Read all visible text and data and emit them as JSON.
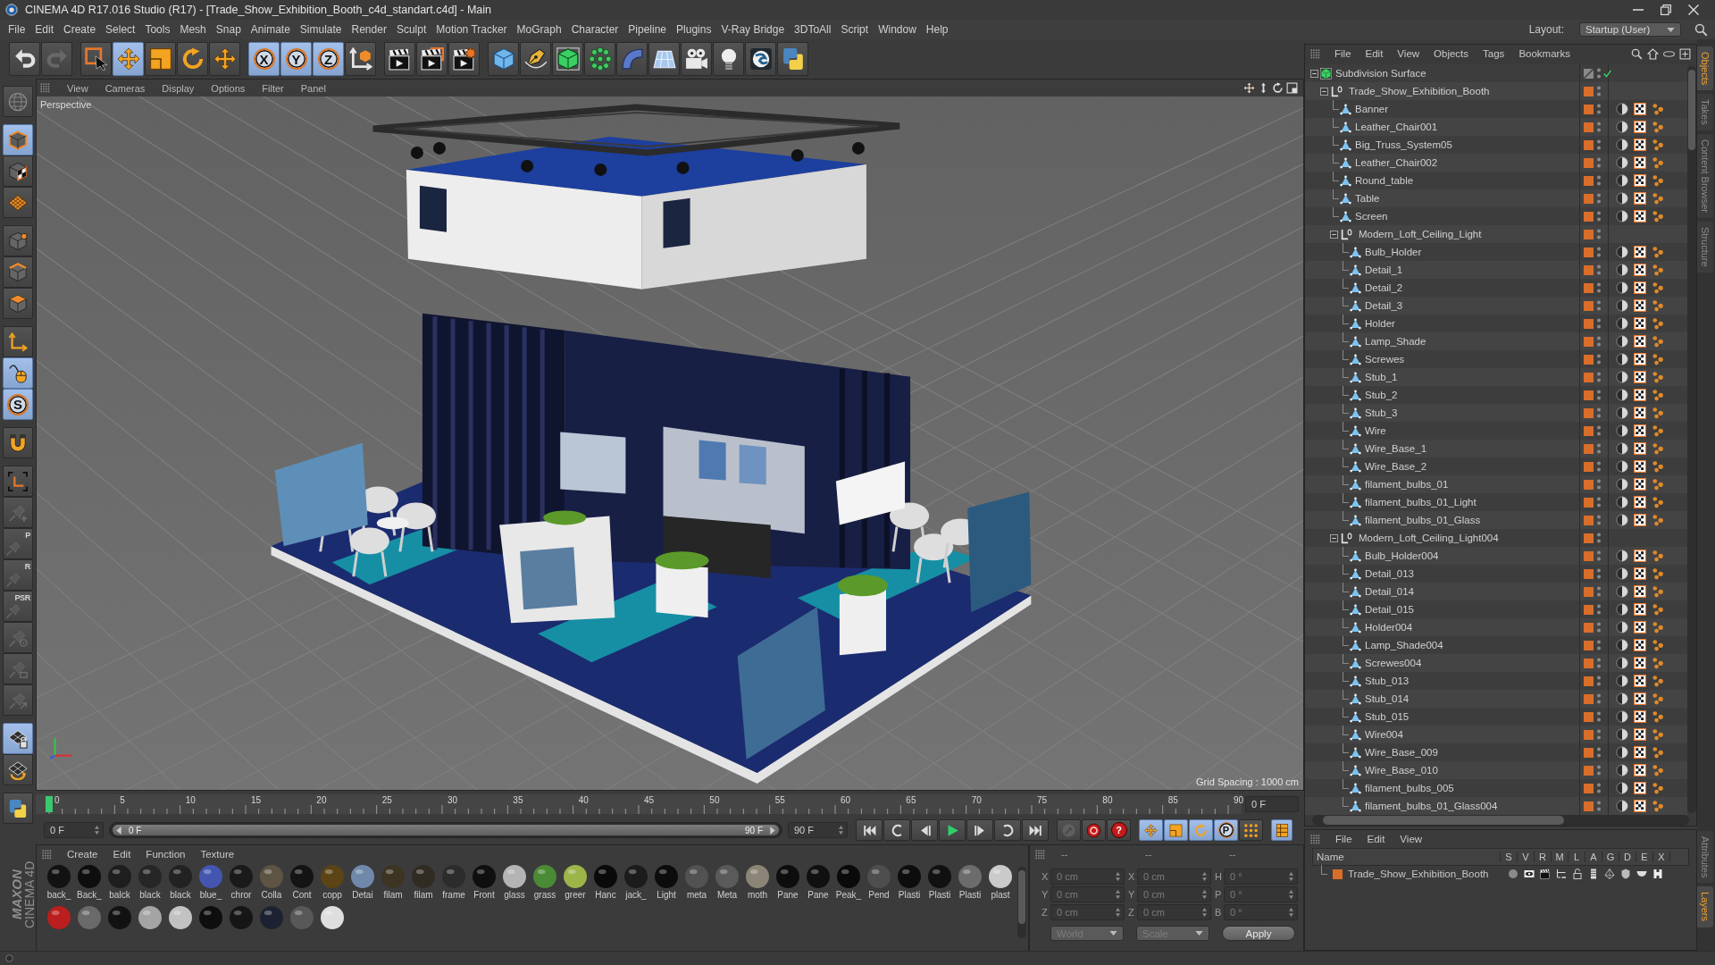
{
  "window": {
    "title": "CINEMA 4D R17.016 Studio (R17) - [Trade_Show_Exhibition_Booth_c4d_standart.c4d] - Main"
  },
  "menu_bar": [
    "File",
    "Edit",
    "Create",
    "Select",
    "Tools",
    "Mesh",
    "Snap",
    "Animate",
    "Simulate",
    "Render",
    "Sculpt",
    "Motion Tracker",
    "MoGraph",
    "Character",
    "Pipeline",
    "Plugins",
    "V-Ray Bridge",
    "3DToAll",
    "Script",
    "Window",
    "Help"
  ],
  "layout": {
    "label": "Layout:",
    "value": "Startup (User)"
  },
  "toolbar": [
    [
      {
        "kind": "undo",
        "on": false,
        "disabled": false
      },
      {
        "kind": "redo",
        "on": false,
        "disabled": true
      }
    ],
    [
      {
        "kind": "select",
        "on": false,
        "disabled": false
      },
      {
        "kind": "move",
        "on": true,
        "disabled": false
      },
      {
        "kind": "scale",
        "on": false,
        "disabled": false
      },
      {
        "kind": "rotate",
        "on": false,
        "disabled": false
      },
      {
        "kind": "move",
        "on": false,
        "disabled": false
      }
    ],
    [
      {
        "kind": "letter",
        "label": "X",
        "on": true,
        "disabled": false
      },
      {
        "kind": "letter",
        "label": "Y",
        "on": true,
        "disabled": false
      },
      {
        "kind": "letter",
        "label": "Z",
        "on": true,
        "disabled": false
      },
      {
        "kind": "coords",
        "on": false,
        "disabled": false
      }
    ],
    [
      {
        "kind": "render_view",
        "on": false,
        "disabled": false
      },
      {
        "kind": "render_picture",
        "on": false,
        "disabled": false
      },
      {
        "kind": "render_settings",
        "on": false,
        "disabled": false
      }
    ],
    [
      {
        "kind": "cube",
        "on": false,
        "disabled": false
      },
      {
        "kind": "pen",
        "on": false,
        "disabled": false
      },
      {
        "kind": "subdiv",
        "on": false,
        "disabled": false
      },
      {
        "kind": "cloner",
        "on": false,
        "disabled": false
      },
      {
        "kind": "bend",
        "on": false,
        "disabled": false
      },
      {
        "kind": "floor",
        "on": false,
        "disabled": false
      },
      {
        "kind": "camera",
        "on": false,
        "disabled": false
      },
      {
        "kind": "light",
        "on": false,
        "disabled": false
      },
      {
        "kind": "vray",
        "on": false,
        "disabled": false
      },
      {
        "kind": "python",
        "on": false,
        "disabled": false
      }
    ]
  ],
  "tool_palette": [
    [
      {
        "kind": "make_editable",
        "on": false,
        "disabled": false
      }
    ],
    [
      {
        "kind": "model",
        "on": true,
        "disabled": false
      },
      {
        "kind": "texture",
        "on": false,
        "disabled": false
      },
      {
        "kind": "workplane",
        "on": false,
        "disabled": false
      }
    ],
    [
      {
        "kind": "points",
        "on": false,
        "disabled": false
      },
      {
        "kind": "edges",
        "on": false,
        "disabled": false
      },
      {
        "kind": "polygons",
        "on": false,
        "disabled": false
      }
    ],
    [
      {
        "kind": "axis",
        "on": false,
        "disabled": false
      },
      {
        "kind": "tweak",
        "on": true,
        "disabled": false
      },
      {
        "kind": "letter",
        "label": "S",
        "on": true,
        "disabled": false
      }
    ],
    [
      {
        "kind": "magnet",
        "on": false,
        "disabled": false
      }
    ],
    [
      {
        "kind": "axis_lock",
        "on": false,
        "disabled": false
      },
      {
        "kind": "pin_plus",
        "on": false,
        "disabled": true
      },
      {
        "kind": "pin",
        "label": "P",
        "on": false,
        "disabled": true
      },
      {
        "kind": "pin",
        "label": "R",
        "on": false,
        "disabled": true
      },
      {
        "kind": "pin",
        "label": "PSR",
        "on": false,
        "disabled": true
      },
      {
        "kind": "pin_target",
        "on": false,
        "disabled": true
      },
      {
        "kind": "pin_globe",
        "on": false,
        "disabled": true
      },
      {
        "kind": "pin_arrow",
        "on": false,
        "disabled": true
      }
    ],
    [
      {
        "kind": "grid_lock",
        "on": true,
        "disabled": false
      },
      {
        "kind": "grid_rotate",
        "on": false,
        "disabled": false
      }
    ],
    [
      {
        "kind": "python",
        "on": false,
        "disabled": false
      }
    ]
  ],
  "viewport": {
    "menu": [
      "View",
      "Cameras",
      "Display",
      "Options",
      "Filter",
      "Panel"
    ],
    "camera": "Perspective",
    "grid_spacing": "Grid Spacing : 1000 cm"
  },
  "timeline": {
    "ticks": [
      "0",
      "5",
      "10",
      "15",
      "20",
      "25",
      "30",
      "35",
      "40",
      "45",
      "50",
      "55",
      "60",
      "65",
      "70",
      "75",
      "80",
      "85",
      "90"
    ],
    "level": 0,
    "current_frame": "0 F",
    "start": "0 F",
    "preview_range": {
      "start": "0 F",
      "end": "90 F",
      "level": 1
    },
    "end": "90 F"
  },
  "playback": {
    "transport": [
      {
        "kind": "first"
      },
      {
        "kind": "prev_key"
      },
      {
        "kind": "prev_frame"
      },
      {
        "kind": "play"
      },
      {
        "kind": "next_frame"
      },
      {
        "kind": "next_key"
      },
      {
        "kind": "last"
      }
    ],
    "record": [
      {
        "kind": "key_record",
        "disabled": true
      },
      {
        "kind": "auto_record",
        "disabled": false
      },
      {
        "kind": "help",
        "label": "?",
        "disabled": false
      }
    ],
    "keys": [
      {
        "kind": "key_move",
        "on": true
      },
      {
        "kind": "key_scale",
        "on": true
      },
      {
        "kind": "key_rotate",
        "on": true
      },
      {
        "kind": "letter",
        "label": "P",
        "on": true
      },
      {
        "kind": "key_pla",
        "on": false
      }
    ],
    "timeline": {
      "kind": "timeline",
      "on": true
    }
  },
  "material_manager": {
    "menu": [
      "Create",
      "Edit",
      "Function",
      "Texture"
    ],
    "materials": [
      {
        "name": "back_",
        "color": "#121212"
      },
      {
        "name": "Back_",
        "color": "#0e0e0e"
      },
      {
        "name": "balck",
        "color": "#1e1e1e"
      },
      {
        "name": "black",
        "color": "#262626"
      },
      {
        "name": "black",
        "color": "#222222"
      },
      {
        "name": "blue_",
        "color": "#4456b0"
      },
      {
        "name": "chror",
        "color": "#1a1a1a"
      },
      {
        "name": "Colla",
        "color": "#5e5444"
      },
      {
        "name": "Cont",
        "color": "#141414"
      },
      {
        "name": "copp",
        "color": "#5c4416"
      },
      {
        "name": "Detai",
        "color": "#7088aa"
      },
      {
        "name": "filam",
        "color": "#3e3424"
      },
      {
        "name": "filam",
        "color": "#302c24"
      },
      {
        "name": "frame",
        "color": "#2c2c2c"
      },
      {
        "name": "Front",
        "color": "#0f0f0f"
      },
      {
        "name": "glass",
        "color": "#b4b4b4"
      },
      {
        "name": "grass",
        "color": "#4a8a34"
      },
      {
        "name": "greer",
        "color": "#9cb448"
      },
      {
        "name": "Hanc",
        "color": "#0a0a0a"
      },
      {
        "name": "jack_",
        "color": "#1c1c1c"
      },
      {
        "name": "Light",
        "color": "#0c0c0c"
      },
      {
        "name": "meta",
        "color": "#525252"
      },
      {
        "name": "Meta",
        "color": "#5a5a5a"
      },
      {
        "name": "moth",
        "color": "#8c8476"
      },
      {
        "name": "Pane",
        "color": "#0d0d0d"
      },
      {
        "name": "Pane",
        "color": "#101010"
      },
      {
        "name": "Peak_",
        "color": "#0a0a0a"
      },
      {
        "name": "Pend",
        "color": "#4e4e4e"
      },
      {
        "name": "Plasti",
        "color": "#0d0d0d"
      },
      {
        "name": "Plasti",
        "color": "#111111"
      },
      {
        "name": "Plasti",
        "color": "#6c6c6c"
      },
      {
        "name": "plast",
        "color": "#cacaca"
      },
      {
        "color": "#bb1e1e"
      },
      {
        "color": "#6a6a6a"
      },
      {
        "color": "#121212"
      },
      {
        "color": "#a4a4a4"
      },
      {
        "color": "#c2c2c2"
      },
      {
        "color": "#0e0e0e"
      },
      {
        "color": "#161616"
      },
      {
        "color": "#1c2232"
      },
      {
        "color": "#585858"
      },
      {
        "color": "#dedede"
      }
    ]
  },
  "coordinates": {
    "disabled": true,
    "headers": [
      "--",
      "--",
      "--"
    ],
    "rows": [
      [
        {
          "axis": "X",
          "value": "0 cm"
        },
        {
          "axis": "X",
          "value": "0 cm"
        },
        {
          "axis": "H",
          "value": "0 °"
        }
      ],
      [
        {
          "axis": "Y",
          "value": "0 cm"
        },
        {
          "axis": "Y",
          "value": "0 cm"
        },
        {
          "axis": "P",
          "value": "0 °"
        }
      ],
      [
        {
          "axis": "Z",
          "value": "0 cm"
        },
        {
          "axis": "Z",
          "value": "0 cm"
        },
        {
          "axis": "B",
          "value": "0 °"
        }
      ]
    ],
    "dropdowns": [
      "World",
      "Scale"
    ],
    "apply": "Apply"
  },
  "object_manager": {
    "menu": [
      "File",
      "Edit",
      "View",
      "Objects",
      "Tags",
      "Bookmarks"
    ],
    "tree": [
      {
        "name": "Subdivision Surface",
        "kind": "subdivision",
        "enabled": true,
        "expanded": true,
        "children": [
          {
            "name": "Trade_Show_Exhibition_Booth",
            "kind": "null",
            "color": "#d86e2a",
            "expanded": true,
            "children": [
              {
                "name": "Banner",
                "kind": "polygon",
                "color": "#d86e2a"
              },
              {
                "name": "Leather_Chair001",
                "kind": "polygon",
                "color": "#d86e2a"
              },
              {
                "name": "Big_Truss_System05",
                "kind": "polygon",
                "color": "#d86e2a"
              },
              {
                "name": "Leather_Chair002",
                "kind": "polygon",
                "color": "#d86e2a"
              },
              {
                "name": "Round_table",
                "kind": "polygon",
                "color": "#d86e2a"
              },
              {
                "name": "Table",
                "kind": "polygon",
                "color": "#d86e2a"
              },
              {
                "name": "Screen",
                "kind": "polygon",
                "color": "#d86e2a"
              },
              {
                "name": "Modern_Loft_Ceiling_Light",
                "kind": "null",
                "color": "#d86e2a",
                "expanded": true,
                "children": [
                  {
                    "name": "Bulb_Holder",
                    "kind": "polygon",
                    "color": "#d86e2a"
                  },
                  {
                    "name": "Detail_1",
                    "kind": "polygon",
                    "color": "#d86e2a"
                  },
                  {
                    "name": "Detail_2",
                    "kind": "polygon",
                    "color": "#d86e2a"
                  },
                  {
                    "name": "Detail_3",
                    "kind": "polygon",
                    "color": "#d86e2a"
                  },
                  {
                    "name": "Holder",
                    "kind": "polygon",
                    "color": "#d86e2a"
                  },
                  {
                    "name": "Lamp_Shade",
                    "kind": "polygon",
                    "color": "#d86e2a"
                  },
                  {
                    "name": "Screwes",
                    "kind": "polygon",
                    "color": "#d86e2a"
                  },
                  {
                    "name": "Stub_1",
                    "kind": "polygon",
                    "color": "#d86e2a"
                  },
                  {
                    "name": "Stub_2",
                    "kind": "polygon",
                    "color": "#d86e2a"
                  },
                  {
                    "name": "Stub_3",
                    "kind": "polygon",
                    "color": "#d86e2a"
                  },
                  {
                    "name": "Wire",
                    "kind": "polygon",
                    "color": "#d86e2a"
                  },
                  {
                    "name": "Wire_Base_1",
                    "kind": "polygon",
                    "color": "#d86e2a"
                  },
                  {
                    "name": "Wire_Base_2",
                    "kind": "polygon",
                    "color": "#d86e2a"
                  },
                  {
                    "name": "filament_bulbs_01",
                    "kind": "polygon",
                    "color": "#d86e2a"
                  },
                  {
                    "name": "filament_bulbs_01_Light",
                    "kind": "polygon",
                    "color": "#d86e2a"
                  },
                  {
                    "name": "filament_bulbs_01_Glass",
                    "kind": "polygon",
                    "color": "#d86e2a"
                  }
                ]
              },
              {
                "name": "Modern_Loft_Ceiling_Light004",
                "kind": "null",
                "color": "#d86e2a",
                "expanded": true,
                "children": [
                  {
                    "name": "Bulb_Holder004",
                    "kind": "polygon",
                    "color": "#d86e2a"
                  },
                  {
                    "name": "Detail_013",
                    "kind": "polygon",
                    "color": "#d86e2a"
                  },
                  {
                    "name": "Detail_014",
                    "kind": "polygon",
                    "color": "#d86e2a"
                  },
                  {
                    "name": "Detail_015",
                    "kind": "polygon",
                    "color": "#d86e2a"
                  },
                  {
                    "name": "Holder004",
                    "kind": "polygon",
                    "color": "#d86e2a"
                  },
                  {
                    "name": "Lamp_Shade004",
                    "kind": "polygon",
                    "color": "#d86e2a"
                  },
                  {
                    "name": "Screwes004",
                    "kind": "polygon",
                    "color": "#d86e2a"
                  },
                  {
                    "name": "Stub_013",
                    "kind": "polygon",
                    "color": "#d86e2a"
                  },
                  {
                    "name": "Stub_014",
                    "kind": "polygon",
                    "color": "#d86e2a"
                  },
                  {
                    "name": "Stub_015",
                    "kind": "polygon",
                    "color": "#d86e2a"
                  },
                  {
                    "name": "Wire004",
                    "kind": "polygon",
                    "color": "#d86e2a"
                  },
                  {
                    "name": "Wire_Base_009",
                    "kind": "polygon",
                    "color": "#d86e2a"
                  },
                  {
                    "name": "Wire_Base_010",
                    "kind": "polygon",
                    "color": "#d86e2a"
                  },
                  {
                    "name": "filament_bulbs_005",
                    "kind": "polygon",
                    "color": "#d86e2a"
                  },
                  {
                    "name": "filament_bulbs_01_Glass004",
                    "kind": "polygon",
                    "color": "#d86e2a"
                  }
                ]
              }
            ]
          }
        ]
      }
    ]
  },
  "layer_manager": {
    "menu": [
      "File",
      "Edit",
      "View"
    ],
    "columns": [
      "Name",
      "S",
      "V",
      "R",
      "M",
      "L",
      "A",
      "G",
      "D",
      "E",
      "X"
    ],
    "layers": [
      {
        "name": "Trade_Show_Exhibition_Booth",
        "color": "#d86e2a"
      }
    ]
  },
  "side_tabs": [
    {
      "label": "Objects",
      "selected": true
    },
    {
      "label": "Takes",
      "selected": false
    },
    {
      "label": "Content Browser",
      "selected": false
    },
    {
      "label": "Structure",
      "selected": false
    }
  ],
  "lower_side_tabs": [
    {
      "label": "Attributes",
      "selected": false
    },
    {
      "label": "Layers",
      "selected": true
    }
  ],
  "logo": {
    "brand": "MAXON",
    "product": "CINEMA 4D"
  }
}
